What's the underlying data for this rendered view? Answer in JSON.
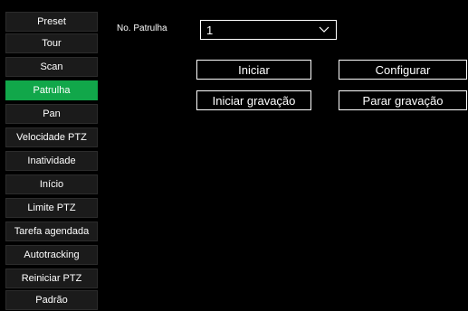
{
  "sidebar": {
    "items": [
      {
        "label": "Preset"
      },
      {
        "label": "Tour"
      },
      {
        "label": "Scan"
      },
      {
        "label": "Patrulha"
      },
      {
        "label": "Pan"
      },
      {
        "label": "Velocidade PTZ"
      },
      {
        "label": "Inatividade"
      },
      {
        "label": "Início"
      },
      {
        "label": "Limite PTZ"
      },
      {
        "label": "Tarefa agendada"
      },
      {
        "label": "Autotracking"
      },
      {
        "label": "Reiniciar PTZ"
      },
      {
        "label": "Padrão"
      }
    ],
    "active": "Patrulha"
  },
  "patrol": {
    "label": "No. Patrulha",
    "selected": "1"
  },
  "buttons": {
    "start": "Iniciar",
    "configure": "Configurar",
    "start_recording": "Iniciar gravação",
    "stop_recording": "Parar gravação"
  },
  "colors": {
    "active": "#11a74a",
    "background": "#000000",
    "item": "#1b1b1b"
  }
}
